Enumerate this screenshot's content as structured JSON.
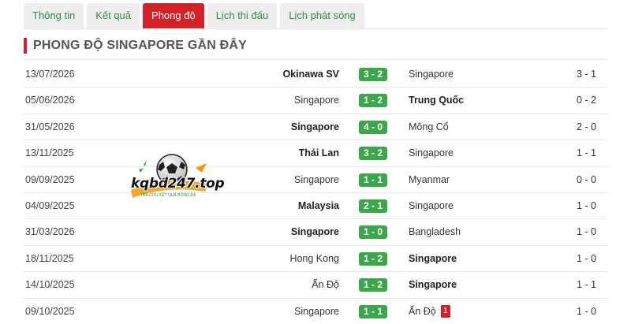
{
  "tabs": [
    {
      "label": "Thông tin",
      "active": false
    },
    {
      "label": "Kết quả",
      "active": false
    },
    {
      "label": "Phong độ",
      "active": true
    },
    {
      "label": "Lịch thi đấu",
      "active": false
    },
    {
      "label": "Lịch phát sóng",
      "active": false
    }
  ],
  "section_title": "PHONG ĐỘ SINGAPORE GẦN ĐÂY",
  "matches": [
    {
      "date": "13/07/2026",
      "home": "Okinawa SV",
      "home_bold": true,
      "score": "3 - 2",
      "away": "Singapore",
      "away_bold": false,
      "ht": "3 - 1"
    },
    {
      "date": "05/06/2026",
      "home": "Singapore",
      "home_bold": false,
      "score": "1 - 2",
      "away": "Trung Quốc",
      "away_bold": true,
      "ht": "0 - 2"
    },
    {
      "date": "31/05/2026",
      "home": "Singapore",
      "home_bold": true,
      "score": "4 - 0",
      "away": "Mông Cổ",
      "away_bold": false,
      "ht": "2 - 0"
    },
    {
      "date": "13/11/2025",
      "home": "Thái Lan",
      "home_bold": true,
      "score": "3 - 2",
      "away": "Singapore",
      "away_bold": false,
      "ht": "1 - 1"
    },
    {
      "date": "09/09/2025",
      "home": "Singapore",
      "home_bold": false,
      "score": "1 - 1",
      "away": "Myanmar",
      "away_bold": false,
      "ht": "0 - 0"
    },
    {
      "date": "04/09/2025",
      "home": "Malaysia",
      "home_bold": true,
      "score": "2 - 1",
      "away": "Singapore",
      "away_bold": false,
      "ht": "1 - 0"
    },
    {
      "date": "31/03/2026",
      "home": "Singapore",
      "home_bold": true,
      "score": "1 - 0",
      "away": "Bangladesh",
      "away_bold": false,
      "ht": "1 - 0"
    },
    {
      "date": "18/11/2025",
      "home": "Hong Kong",
      "home_bold": false,
      "score": "1 - 2",
      "away": "Singapore",
      "away_bold": true,
      "ht": "1 - 0"
    },
    {
      "date": "14/10/2025",
      "home": "Ấn Độ",
      "home_bold": false,
      "score": "1 - 2",
      "away": "Singapore",
      "away_bold": true,
      "ht": "1 - 1"
    },
    {
      "date": "09/10/2025",
      "home": "Singapore",
      "home_bold": false,
      "score": "1 - 1",
      "away": "Ấn Độ",
      "away_bold": false,
      "away_red_card": "1",
      "ht": "1 - 0"
    }
  ],
  "watermark": {
    "logo_text": "kqbd247.top",
    "tagline": "TRA CỨU KẾT QUẢ BÓNG ĐÁ"
  },
  "colors": {
    "accent_red": "#d3212a",
    "score_green": "#3aa84a",
    "tab_text_green": "#2f8f3f"
  }
}
